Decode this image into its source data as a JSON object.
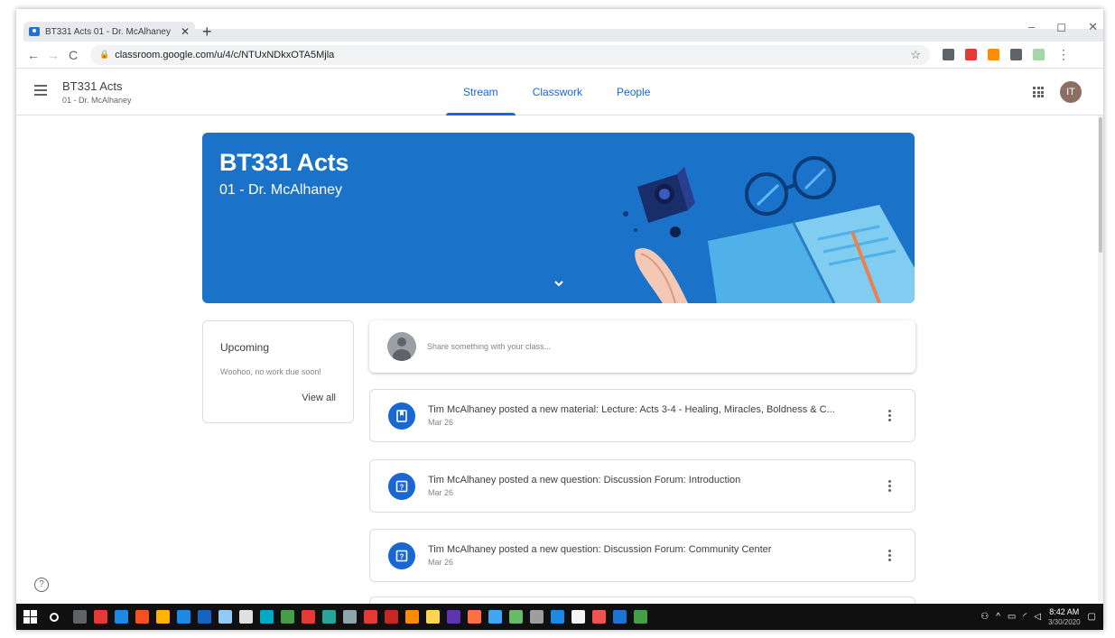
{
  "browser": {
    "tab_title": "BT331 Acts 01 - Dr. McAlhaney",
    "tab_close": "✕",
    "new_tab": "+",
    "url": "classroom.google.com/u/4/c/NTUxNDkxOTA5Mjla",
    "window_controls": {
      "minimize": "–",
      "maximize": "◻",
      "close": "✕"
    },
    "extension_colors": [
      "#5f6368",
      "#e53935",
      "#ff8f00",
      "#5f6368",
      "#a5d6a7"
    ]
  },
  "header": {
    "course_title": "BT331 Acts",
    "course_section": "01 - Dr. McAlhaney",
    "tabs": [
      {
        "label": "Stream",
        "active": true
      },
      {
        "label": "Classwork",
        "active": false
      },
      {
        "label": "People",
        "active": false
      }
    ],
    "avatar_initials": "IT",
    "avatar_color": "#8d6e63"
  },
  "banner": {
    "title": "BT331 Acts",
    "subtitle": "01 - Dr. McAlhaney",
    "color": "#1a73c8"
  },
  "upcoming": {
    "title": "Upcoming",
    "message": "Woohoo, no work due soon!",
    "link": "View all"
  },
  "share": {
    "placeholder": "Share something with your class..."
  },
  "posts": [
    {
      "type": "material",
      "icon": "material-icon",
      "title": "Tim McAlhaney posted a new material: Lecture: Acts 3-4 - Healing, Miracles, Boldness & C...",
      "date": "Mar 26"
    },
    {
      "type": "question",
      "icon": "question-icon",
      "title": "Tim McAlhaney posted a new question: Discussion Forum: Introduction",
      "date": "Mar 26"
    },
    {
      "type": "question",
      "icon": "question-icon",
      "title": "Tim McAlhaney posted a new question: Discussion Forum: Community Center",
      "date": "Mar 26"
    }
  ],
  "help_label": "?",
  "taskbar": {
    "app_colors": [
      "#5f6368",
      "#e53935",
      "#1e88e5",
      "#f4511e",
      "#ffb300",
      "#1e88e5",
      "#1565c0",
      "#90caf9",
      "#e0e0e0",
      "#00acc1",
      "#43a047",
      "#e53935",
      "#26a69a",
      "#90a4ae",
      "#e53935",
      "#c62828",
      "#fb8c00",
      "#ffd54f",
      "#5e35b1",
      "#ff7043",
      "#42a5f5",
      "#66bb6a",
      "#9e9e9e",
      "#1e88e5",
      "#f5f5f5",
      "#ef5350",
      "#1976d2",
      "#43a047"
    ],
    "time": "8:42 AM",
    "date": "3/30/2020"
  }
}
